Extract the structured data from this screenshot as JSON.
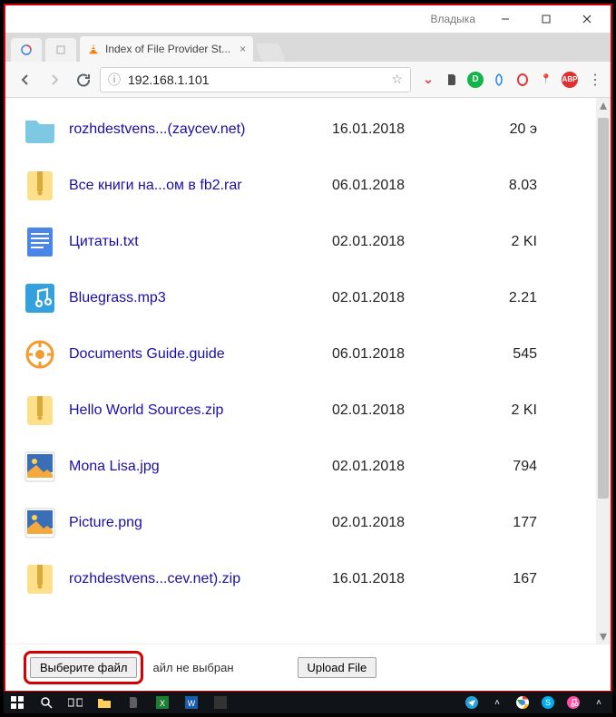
{
  "window": {
    "user_label": "Владыка"
  },
  "tabs": {
    "active": {
      "title": "Index of File Provider St..."
    }
  },
  "address": {
    "url": "192.168.1.101"
  },
  "files": [
    {
      "icon": "folder",
      "name": "rozhdestvens...(zaycev.net)",
      "date": "16.01.2018",
      "size": "20 э"
    },
    {
      "icon": "zip",
      "name": "Все книги на...ом в fb2.rar",
      "date": "06.01.2018",
      "size": "8.03"
    },
    {
      "icon": "txt",
      "name": "Цитаты.txt",
      "date": "02.01.2018",
      "size": "2 KI"
    },
    {
      "icon": "audio",
      "name": "Bluegrass.mp3",
      "date": "02.01.2018",
      "size": "2.21"
    },
    {
      "icon": "guide",
      "name": "Documents Guide.guide",
      "date": "06.01.2018",
      "size": "545"
    },
    {
      "icon": "zip",
      "name": "Hello World Sources.zip",
      "date": "02.01.2018",
      "size": "2 KI"
    },
    {
      "icon": "image",
      "name": "Mona Lisa.jpg",
      "date": "02.01.2018",
      "size": "794"
    },
    {
      "icon": "image",
      "name": "Picture.png",
      "date": "02.01.2018",
      "size": "177"
    },
    {
      "icon": "zip",
      "name": "rozhdestvens...cev.net).zip",
      "date": "16.01.2018",
      "size": "167"
    }
  ],
  "footer": {
    "choose_label": "Выберите файл",
    "no_file": "айл не выбран",
    "upload_label": "Upload File"
  }
}
